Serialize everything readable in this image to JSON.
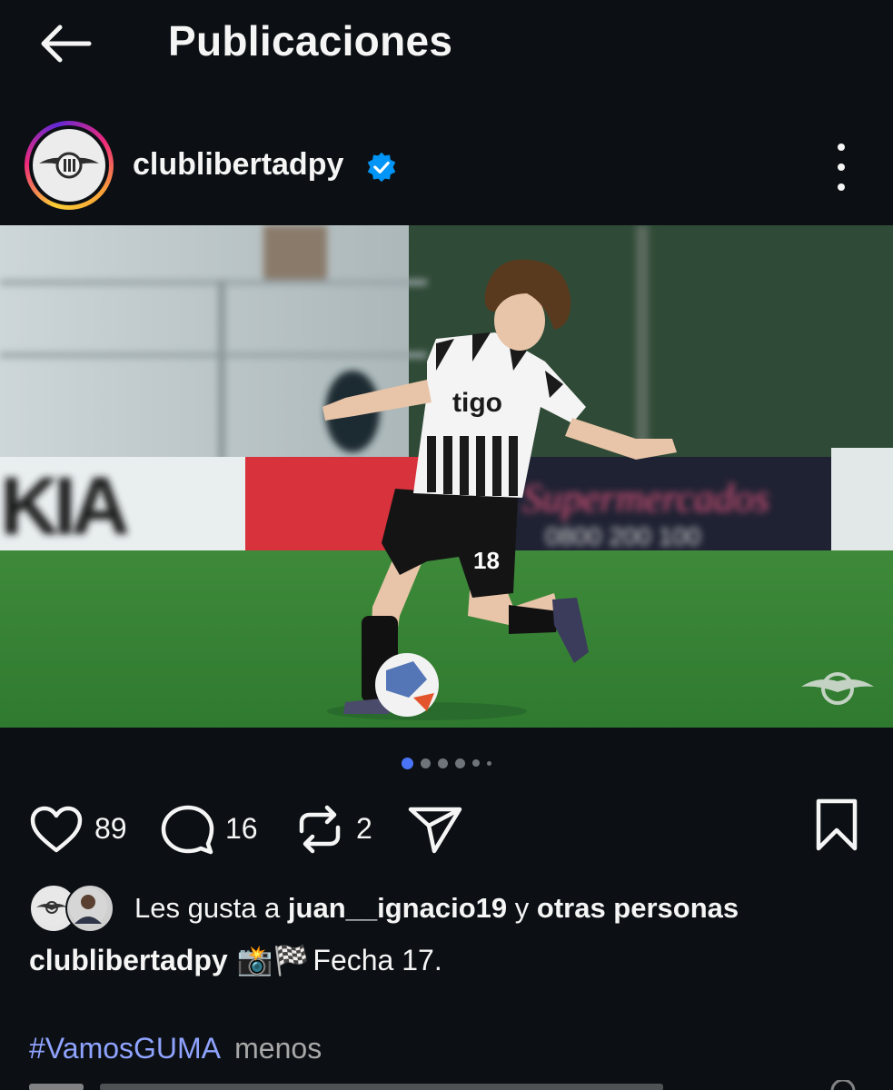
{
  "header": {
    "title": "Publicaciones"
  },
  "post": {
    "username": "clublibertadpy",
    "verified": true,
    "carousel": {
      "total": 6,
      "current": 1
    },
    "actions": {
      "likes": "89",
      "comments": "16",
      "reposts": "2"
    },
    "liked_by": {
      "prefix": "Les gusta a",
      "user": "juan__ignacio19",
      "joiner": "y",
      "others": "otras personas"
    },
    "caption": {
      "username": "clublibertadpy",
      "emoji": "📸🏁",
      "text": "Fecha 17."
    },
    "hashtag": "#VamosGUMA",
    "less_label": "menos"
  },
  "icons": [
    "back-arrow-icon",
    "verified-badge-icon",
    "more-icon",
    "heart-icon",
    "comment-icon",
    "repost-icon",
    "share-icon",
    "bookmark-icon"
  ],
  "colors": {
    "background": "#0c1014",
    "text": "#f5f5f5",
    "verified": "#0095f6",
    "hashtag": "#8fa3ff",
    "carousel_active": "#4a74f5"
  }
}
